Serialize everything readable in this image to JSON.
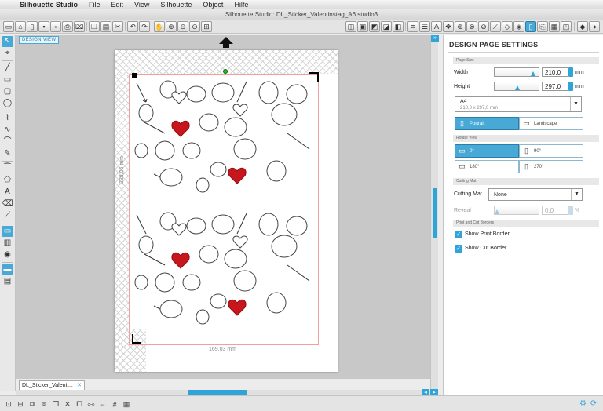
{
  "menubar": {
    "app_name": "Silhouette Studio",
    "menus": [
      "File",
      "Edit",
      "View",
      "Silhouette",
      "Object",
      "Hilfe"
    ],
    "document_title": "Silhouette Studio: DL_Sticker_Valentinstag_A6.studio3"
  },
  "toolbar": {
    "icons": [
      "new-file-icon",
      "open-icon",
      "library-icon",
      "save-icon",
      "save-as-icon",
      "print-icon",
      "print-cut-icon",
      "copy-icon",
      "paste-icon",
      "cut-icon",
      "undo-icon",
      "redo-icon",
      "pan-hand-icon",
      "zoom-in-icon",
      "zoom-out-icon",
      "zoom-drag-icon",
      "zoom-fit-icon",
      "select-all-icon"
    ],
    "right_icons": [
      "offset-icon",
      "trace-icon",
      "fill-icon",
      "line-color-icon",
      "line-style-icon",
      "text-icon",
      "transform-icon",
      "replicate-icon",
      "modify-icon",
      "align-icon",
      "knife-icon",
      "page-settings-icon",
      "cut-settings-icon",
      "send-silhouette-icon",
      "registration-icon",
      "preferences-icon",
      "scale-icon",
      "store-icon",
      "library-toggle-icon"
    ]
  },
  "canvas": {
    "view_tag": "DESIGN VIEW",
    "height_dimension": "238,06 mm",
    "width_dimension": "169,03 mm",
    "document_tab": "DL_Sticker_Valenti..."
  },
  "panel": {
    "title": "DESIGN PAGE SETTINGS",
    "page_size": {
      "section": "Page Size",
      "width_label": "Width",
      "width_value": "210,0",
      "width_fraction": 0.88,
      "height_label": "Height",
      "height_value": "297,0",
      "height_fraction": 0.5,
      "unit": "mm",
      "preset_name": "A4",
      "preset_dims": "210,0 x 297,0 mm",
      "portrait_label": "Portrait",
      "landscape_label": "Landscape"
    },
    "rotate_view": {
      "section": "Rotate View",
      "options": [
        "0°",
        "90°",
        "180°",
        "270°"
      ],
      "selected": "0°"
    },
    "cutting_mat": {
      "section": "Cutting Mat",
      "label": "Cutting Mat",
      "value": "None",
      "reveal_label": "Reveal",
      "reveal_value": "0,0",
      "reveal_unit": "%"
    },
    "borders": {
      "section": "Print and Cut Borders",
      "show_print_border": "Show Print Border",
      "show_cut_border": "Show Cut Border",
      "print_checked": true,
      "cut_checked": true
    }
  },
  "colors": {
    "accent": "#2fa4d8",
    "heart_red": "#c8161d",
    "cut_line": "#f1a0a0"
  }
}
